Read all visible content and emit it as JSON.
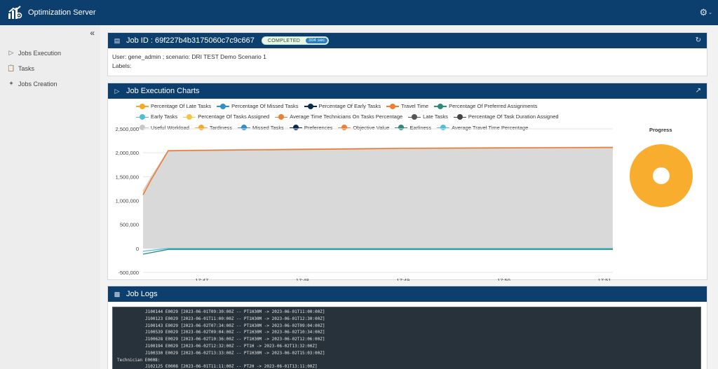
{
  "app": {
    "title": "Optimization Server",
    "brand_color": "#0d3f6e"
  },
  "sidebar": {
    "items": [
      {
        "label": "Jobs Execution",
        "icon": "play-icon"
      },
      {
        "label": "Tasks",
        "icon": "clipboard-icon"
      },
      {
        "label": "Jobs Creation",
        "icon": "wand-icon"
      }
    ]
  },
  "job": {
    "id_label": "Job ID : 69f227b4b3175060c7c9c667",
    "status": "COMPLETED",
    "duration": "304 sec",
    "user_line": "User: gene_admin ; scenario: DRI TEST Demo Scenario 1",
    "labels_line": "Labels:"
  },
  "charts": {
    "title": "Job Execution Charts",
    "progress_title": "Progress",
    "legend": [
      {
        "label": "Percentage Of Late Tasks",
        "color": "#f9a825"
      },
      {
        "label": "Percentage Of Missed Tasks",
        "color": "#2f8fc9"
      },
      {
        "label": "Percentage Of Early Tasks",
        "color": "#0b2b4a"
      },
      {
        "label": "Travel Time",
        "color": "#ef7d32"
      },
      {
        "label": "Percentage Of Preferred Assignments",
        "color": "#2e8a7a"
      },
      {
        "label": "Early Tasks",
        "color": "#4dc0d8"
      },
      {
        "label": "Percentage Of Tasks Assigned",
        "color": "#f4c542"
      },
      {
        "label": "Average Time Technicians On Tasks Percentage",
        "color": "#ef7d32"
      },
      {
        "label": "Late Tasks",
        "color": "#555555"
      },
      {
        "label": "Percentage Of Task Duration Assigned",
        "color": "#444444"
      },
      {
        "label": "Useful Workload",
        "color": "#c8c8c8"
      },
      {
        "label": "Tardiness",
        "color": "#f9a825"
      },
      {
        "label": "Missed Tasks",
        "color": "#2f8fc9"
      },
      {
        "label": "Preferences",
        "color": "#0b2b4a"
      },
      {
        "label": "Objective Value",
        "color": "#ef7d32"
      },
      {
        "label": "Earliness",
        "color": "#2e8a7a"
      },
      {
        "label": "Average Travel Time Percentage",
        "color": "#4dc0d8"
      }
    ]
  },
  "chart_data": [
    {
      "type": "area",
      "title": "",
      "y_ticks": [
        "2,500,000",
        "2,000,000",
        "1,500,000",
        "1,000,000",
        "500,000",
        "0",
        "-500,000"
      ],
      "x_ticks": [
        "17:47",
        "17:48",
        "17:49",
        "17:50",
        "17:51"
      ],
      "ylim": [
        -500000,
        2500000
      ],
      "series": [
        {
          "name": "Useful Workload",
          "color": "#cfcfcf",
          "x": [
            "17:46:25",
            "17:46:30",
            "17:46:40",
            "17:47",
            "17:48",
            "17:49",
            "17:50",
            "17:51",
            "17:51:05"
          ],
          "values": [
            1200000,
            1500000,
            2050000,
            2060000,
            2080000,
            2100000,
            2110000,
            2120000,
            2120000
          ]
        },
        {
          "name": "Travel Time",
          "color": "#ef7d32",
          "x": [
            "17:46:25",
            "17:46:30",
            "17:46:40",
            "17:47",
            "17:48",
            "17:49",
            "17:50",
            "17:51",
            "17:51:05"
          ],
          "values": [
            1120000,
            1450000,
            2040000,
            2050000,
            2070000,
            2090000,
            2100000,
            2110000,
            2110000
          ]
        },
        {
          "name": "Earliness",
          "color": "#2e8a7a",
          "x": [
            "17:46:25",
            "17:46:40",
            "17:47",
            "17:48",
            "17:49",
            "17:50",
            "17:51",
            "17:51:05"
          ],
          "values": [
            -120000,
            -20000,
            -20000,
            -20000,
            -20000,
            -20000,
            -20000,
            -20000
          ]
        },
        {
          "name": "Average Travel Time Percentage",
          "color": "#4dc0d8",
          "x": [
            "17:46:25",
            "17:46:40",
            "17:47",
            "17:48",
            "17:49",
            "17:50",
            "17:51",
            "17:51:05"
          ],
          "values": [
            -60000,
            0,
            0,
            0,
            0,
            0,
            0,
            0
          ]
        }
      ]
    },
    {
      "type": "pie",
      "title": "Progress",
      "slices": [
        {
          "label": "Progress",
          "value": 100,
          "color": "#f9ad2f"
        }
      ]
    }
  ],
  "logs": {
    "title": "Job Logs",
    "lines": [
      {
        "text": "J100144 E0029 [2023-06-01T09:30:00Z -- PT1H30M -> 2023-06-01T11:00:00Z]",
        "indent": true
      },
      {
        "text": "J100123 E0029 [2023-06-01T11:00:00Z -- PT1H30M -> 2023-06-01T12:30:00Z]",
        "indent": true
      },
      {
        "text": "J100143 E0029 [2023-06-02T07:34:00Z -- PT1H30M -> 2023-06-02T09:04:00Z]",
        "indent": true
      },
      {
        "text": "J100539 E0029 [2023-06-02T09:04:00Z -- PT1H30M -> 2023-06-02T10:34:00Z]",
        "indent": true
      },
      {
        "text": "J100628 E0029 [2023-06-02T10:36:00Z -- PT1H30M -> 2023-06-02T12:06:00Z]",
        "indent": true
      },
      {
        "text": "J100194 E0029 [2023-06-02T12:32:00Z -- PT1H -> 2023-06-02T13:32:00Z]",
        "indent": true
      },
      {
        "text": "J100330 E0029 [2023-06-02T13:33:00Z -- PT1H30M -> 2023-06-02T15:03:00Z]",
        "indent": true
      },
      {
        "text": "Technician E0008:",
        "indent": false
      },
      {
        "text": "J102125 E0008 [2023-06-01T11:11:00Z -- PT2H -> 2023-06-01T13:11:00Z]",
        "indent": true
      }
    ]
  }
}
